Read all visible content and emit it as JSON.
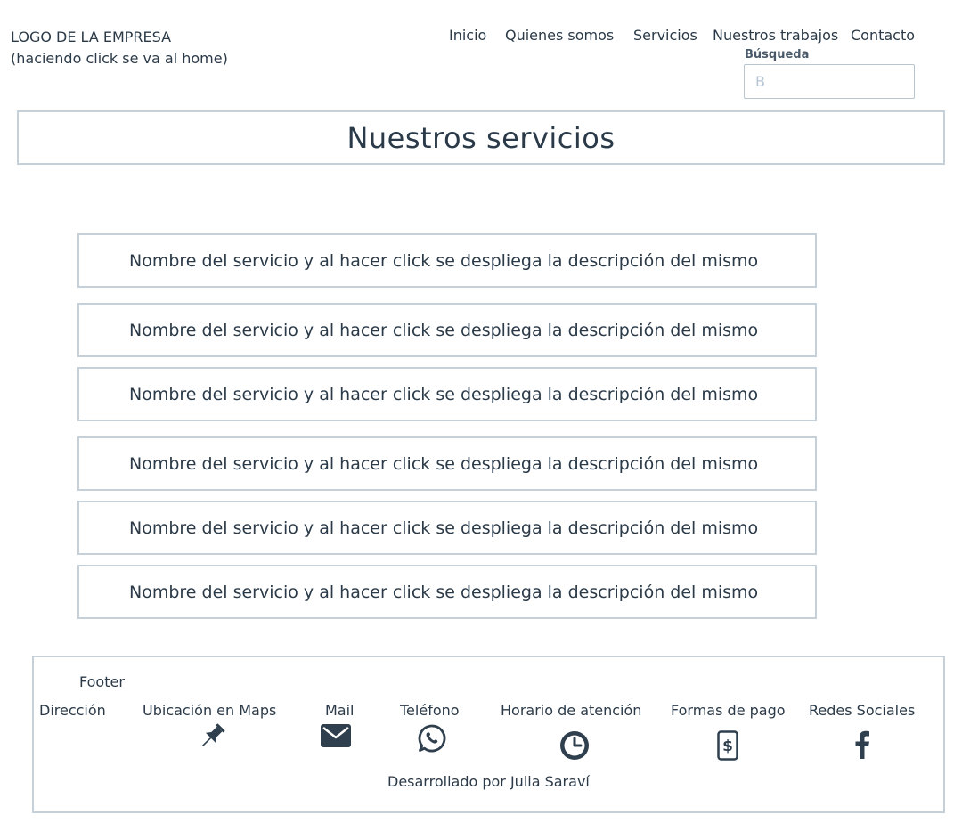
{
  "header": {
    "logo_line1": "LOGO DE LA EMPRESA",
    "logo_line2": "(haciendo click se va al home)",
    "nav": [
      "Inicio",
      "Quienes somos",
      "Servicios",
      "Nuestros trabajos",
      "Contacto"
    ],
    "search_label": "Búsqueda",
    "search_placeholder": "B"
  },
  "page_title": "Nuestros servicios",
  "services": [
    "Nombre del servicio y al hacer click se despliega la descripción del mismo",
    "Nombre del servicio y al hacer click se despliega la descripción del mismo",
    "Nombre del servicio y al hacer click se despliega la descripción del mismo",
    "Nombre del servicio y al hacer click se despliega la descripción del mismo",
    "Nombre del servicio y al hacer click se despliega la descripción del mismo",
    "Nombre del servicio y al hacer click se despliega la descripción del mismo"
  ],
  "footer": {
    "title": "Footer",
    "items": [
      {
        "label": "Dirección",
        "icon": ""
      },
      {
        "label": "Ubicación en Maps",
        "icon": "pushpin-icon"
      },
      {
        "label": "Mail",
        "icon": "mail-icon"
      },
      {
        "label": "Teléfono",
        "icon": "whatsapp-icon"
      },
      {
        "label": "Horario de atención",
        "icon": "clock-icon"
      },
      {
        "label": "Formas de pago",
        "icon": "payment-dollar-icon"
      },
      {
        "label": "Redes Sociales",
        "icon": "facebook-icon"
      }
    ],
    "credit": "Desarrollado por Julia Saraví"
  },
  "colors": {
    "text": "#2b3a48",
    "border": "#c5d0d8",
    "placeholder": "#b7c5d4",
    "icon": "#2f3f4e"
  }
}
